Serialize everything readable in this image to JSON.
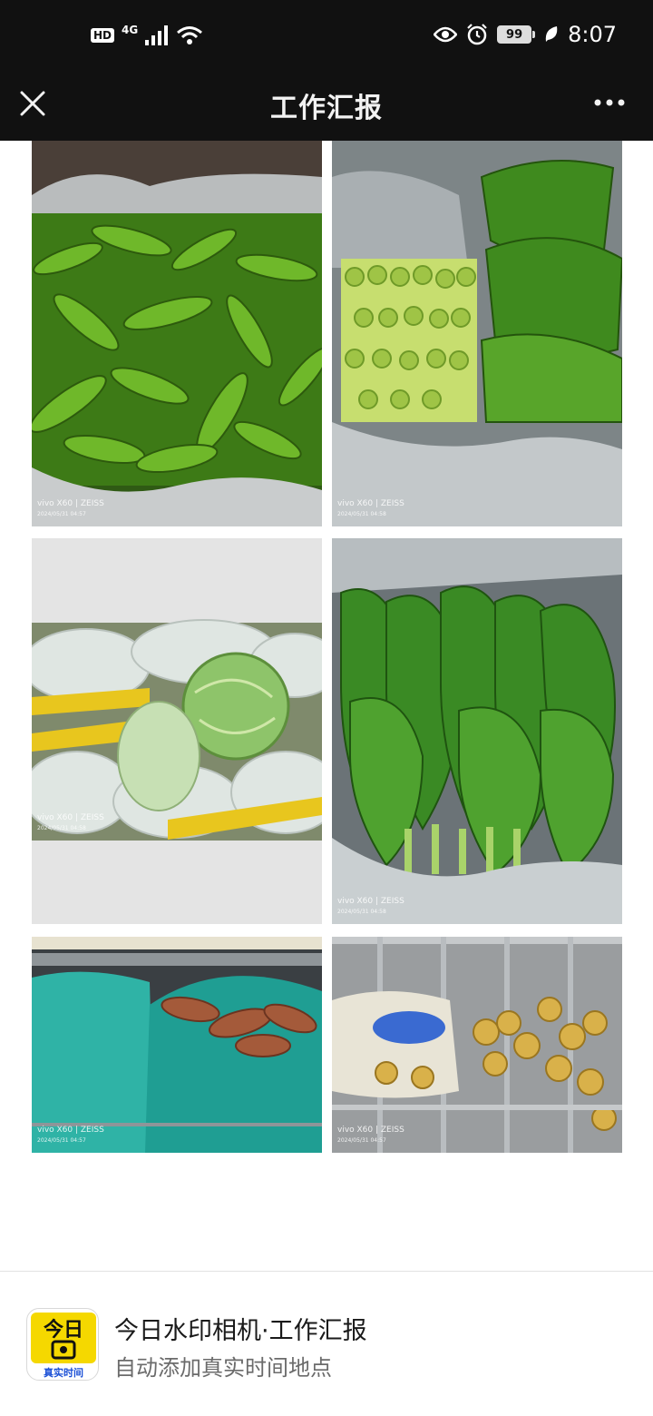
{
  "status_bar": {
    "hd": "HD",
    "network": "4G",
    "battery": "99",
    "time": "8:07",
    "icons": [
      "signal-icon",
      "wifi-icon",
      "eye-icon",
      "alarm-icon",
      "battery-icon",
      "leaf-icon"
    ]
  },
  "header": {
    "title": "工作汇报",
    "close_icon": "close-icon",
    "more_icon": "more-icon"
  },
  "photos": [
    {
      "subject": "green peppers",
      "watermark_brand": "vivo X60 | ZEISS",
      "watermark_date": "2024/05/31 04:57"
    },
    {
      "subject": "stem lettuce",
      "watermark_brand": "vivo X60 | ZEISS",
      "watermark_date": "2024/05/31 04:58"
    },
    {
      "subject": "cabbage",
      "watermark_brand": "vivo X60 | ZEISS",
      "watermark_date": "2024/05/31 04:58"
    },
    {
      "subject": "mustard greens",
      "watermark_brand": "vivo X60 | ZEISS",
      "watermark_date": "2024/05/31 04:58"
    },
    {
      "subject": "sweet potatoes",
      "watermark_brand": "vivo X60 | ZEISS",
      "watermark_date": "2024/05/31 04:57"
    },
    {
      "subject": "ginger",
      "watermark_brand": "vivo X60 | ZEISS",
      "watermark_date": "2024/05/31 04:57"
    }
  ],
  "footer": {
    "app_name": "今日水印相机·工作汇报",
    "app_desc": "自动添加真实时间地点",
    "icon_top_text": "今日",
    "icon_bottom_text": "真实时间",
    "accent": "#f5d800"
  }
}
